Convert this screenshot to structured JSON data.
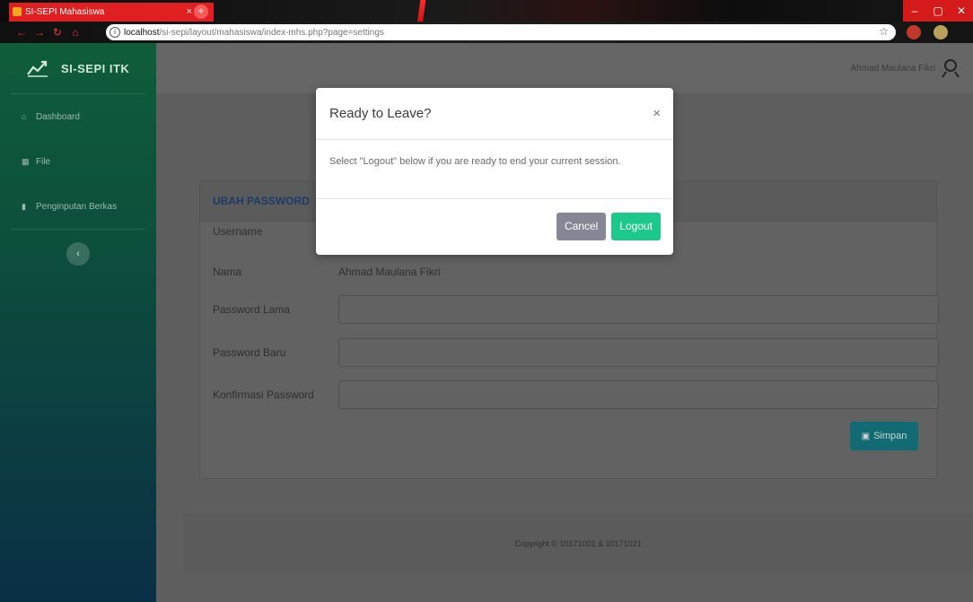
{
  "browser": {
    "tab_title": "SI-SEPI Mahasiswa",
    "tab_close": "×",
    "new_tab": "+",
    "url_host": "localhost",
    "url_path": "/si-sepi/layout/mahasiswa/index-mhs.php?page=settings",
    "minimize": "–",
    "maximize": "▢",
    "close": "✕"
  },
  "sidebar": {
    "brand": "SI-SEPI ITK",
    "items": [
      {
        "label": "Dashboard",
        "icon": "home-icon"
      },
      {
        "label": "File",
        "icon": "table-icon"
      },
      {
        "label": "Penginputan Berkas",
        "icon": "bar-chart-icon"
      }
    ],
    "toggle": "‹"
  },
  "topbar": {
    "user_name": "Ahmad Maulana Fikri"
  },
  "card": {
    "title": "UBAH PASSWORD",
    "rows": [
      {
        "label": "Username",
        "value": ""
      },
      {
        "label": "Nama",
        "value": "Ahmad Maulana Fikri"
      },
      {
        "label": "Password Lama",
        "value": ""
      },
      {
        "label": "Password Baru",
        "value": ""
      },
      {
        "label": "Konfirmasi Password",
        "value": ""
      }
    ],
    "save_label": "Simpan"
  },
  "footer": {
    "text": "Copyright © 10171001 & 10171021"
  },
  "modal": {
    "title": "Ready to Leave?",
    "close": "×",
    "body": "Select \"Logout\" below if you are ready to end your current session.",
    "cancel_label": "Cancel",
    "logout_label": "Logout"
  },
  "colors": {
    "sidebar_top": "#0f5d3a",
    "sidebar_bottom": "#0a2f45",
    "logout_button": "#1cc88a",
    "cancel_button": "#858796",
    "save_button": "#126b73",
    "tab_red": "#e02020"
  }
}
